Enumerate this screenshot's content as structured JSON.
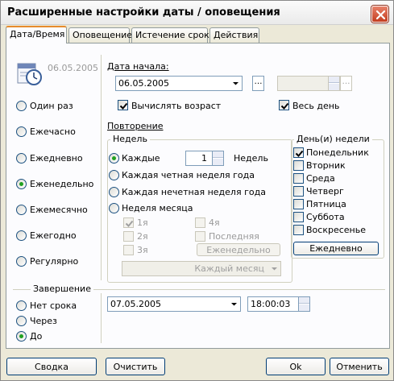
{
  "window": {
    "title": "Расширенные настройки даты / оповещения"
  },
  "tabs": [
    "Дата/Время",
    "Оповещение",
    "Истечение срока",
    "Действия"
  ],
  "icon_date": "06.05.2005",
  "recurrence_types": [
    "Один раз",
    "Ежечасно",
    "Ежедневно",
    "Еженедельно",
    "Ежемесячно",
    "Ежегодно",
    "Регулярно"
  ],
  "recurrence_selected": "Еженедельно",
  "start": {
    "label": "Дата начала:",
    "date": "06.05.2005",
    "time_placeholder": "",
    "calc_age_label": "Вычислять возраст",
    "calc_age_checked": true,
    "all_day_label": "Весь день",
    "all_day_checked": true
  },
  "repeat": {
    "label": "Повторение",
    "weeks_legend": "Недель",
    "every_label": "Каждые",
    "every_value": "1",
    "weeks_unit": "Недель",
    "options": [
      "Каждая четная неделя года",
      "Каждая нечетная неделя года",
      "Неделя месяца"
    ],
    "week_of_month": [
      "1я",
      "2я",
      "3я",
      "4я",
      "Последняя"
    ],
    "weekly_button": "Еженедельно",
    "monthly_select": "Каждый месяц"
  },
  "weekdays": {
    "legend": "День(и) недели",
    "days": [
      "Понедельник",
      "Вторник",
      "Среда",
      "Четверг",
      "Пятница",
      "Суббота",
      "Воскресенье"
    ],
    "checked": [
      true,
      false,
      false,
      false,
      false,
      false,
      false
    ],
    "daily_button": "Ежедневно"
  },
  "end": {
    "legend": "Завершение",
    "options": [
      "Нет срока",
      "Через",
      "До"
    ],
    "selected": "До",
    "date": "07.05.2005",
    "time": "18:00:03"
  },
  "buttons": {
    "summary": "Сводка",
    "clear": "Очистить",
    "ok": "Ok",
    "cancel": "Отменить"
  },
  "colors": {
    "accent_tab": "#e68b2c",
    "radio_dot": "#21a121",
    "close": "#c33d1f"
  }
}
